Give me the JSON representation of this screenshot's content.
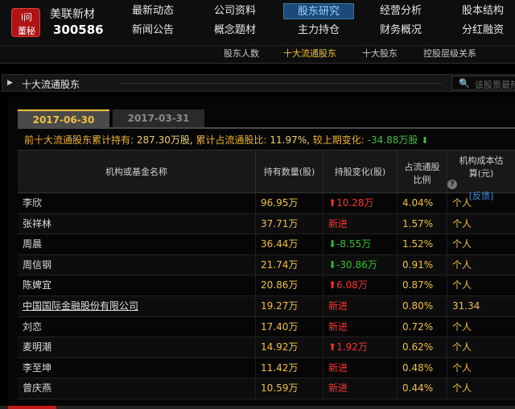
{
  "logo": {
    "line1": "i问",
    "line2": "董秘"
  },
  "stock": {
    "name": "美联新材",
    "code": "300586"
  },
  "nav": {
    "row1": [
      "最新动态",
      "公司资料",
      "股东研究",
      "经营分析",
      "股本结构"
    ],
    "row2": [
      "新闻公告",
      "概念题材",
      "主力持仓",
      "财务概况",
      "分红融资"
    ],
    "active": "股东研究"
  },
  "subnav": [
    "股东人数",
    "十大流通股东",
    "十大股东",
    "控股层级关系"
  ],
  "section": {
    "title": "十大流通股东",
    "search_placeholder": "该股票最热"
  },
  "tabs": {
    "active": "2017-06-30",
    "inactive": "2017-03-31"
  },
  "summary": {
    "label1": "前十大流通股东累计持有:",
    "value1": "287.30万股,",
    "label2": "累计占流通股比:",
    "value2": "11.97%,",
    "label3": "较上期变化:",
    "value3": "-34.88万股"
  },
  "table": {
    "headers": {
      "name": "机构或基金名称",
      "qty": "持有数量(股)",
      "chg": "持股变化(股)",
      "ratio_l1": "占流通股",
      "ratio_l2": "比例",
      "cost_l1": "机构成本估",
      "cost_l2": "算(元)",
      "feedback": "[反馈]"
    },
    "rows": [
      {
        "name": "李欣",
        "qty": "96.95万",
        "chg": "10.28万",
        "dir": "up",
        "ratio": "4.04%",
        "cost": "个人"
      },
      {
        "name": "张祥林",
        "qty": "37.71万",
        "chg": "新进",
        "dir": "new",
        "ratio": "1.57%",
        "cost": "个人"
      },
      {
        "name": "周晨",
        "qty": "36.44万",
        "chg": "-8.55万",
        "dir": "down",
        "ratio": "1.52%",
        "cost": "个人"
      },
      {
        "name": "周信钢",
        "qty": "21.74万",
        "chg": "-30.86万",
        "dir": "down",
        "ratio": "0.91%",
        "cost": "个人"
      },
      {
        "name": "陈婢宜",
        "qty": "20.86万",
        "chg": "6.08万",
        "dir": "up",
        "ratio": "0.87%",
        "cost": "个人"
      },
      {
        "name": "中国国际金融股份有限公司",
        "qty": "19.27万",
        "chg": "新进",
        "dir": "new",
        "ratio": "0.80%",
        "cost": "31.34"
      },
      {
        "name": "刘恋",
        "qty": "17.40万",
        "chg": "新进",
        "dir": "new",
        "ratio": "0.72%",
        "cost": "个人"
      },
      {
        "name": "麦明潮",
        "qty": "14.92万",
        "chg": "1.92万",
        "dir": "up",
        "ratio": "0.62%",
        "cost": "个人"
      },
      {
        "name": "李至坤",
        "qty": "11.42万",
        "chg": "新进",
        "dir": "new",
        "ratio": "0.48%",
        "cost": "个人"
      },
      {
        "name": "曾庆燕",
        "qty": "10.59万",
        "chg": "新进",
        "dir": "new",
        "ratio": "0.44%",
        "cost": "个人"
      }
    ]
  }
}
